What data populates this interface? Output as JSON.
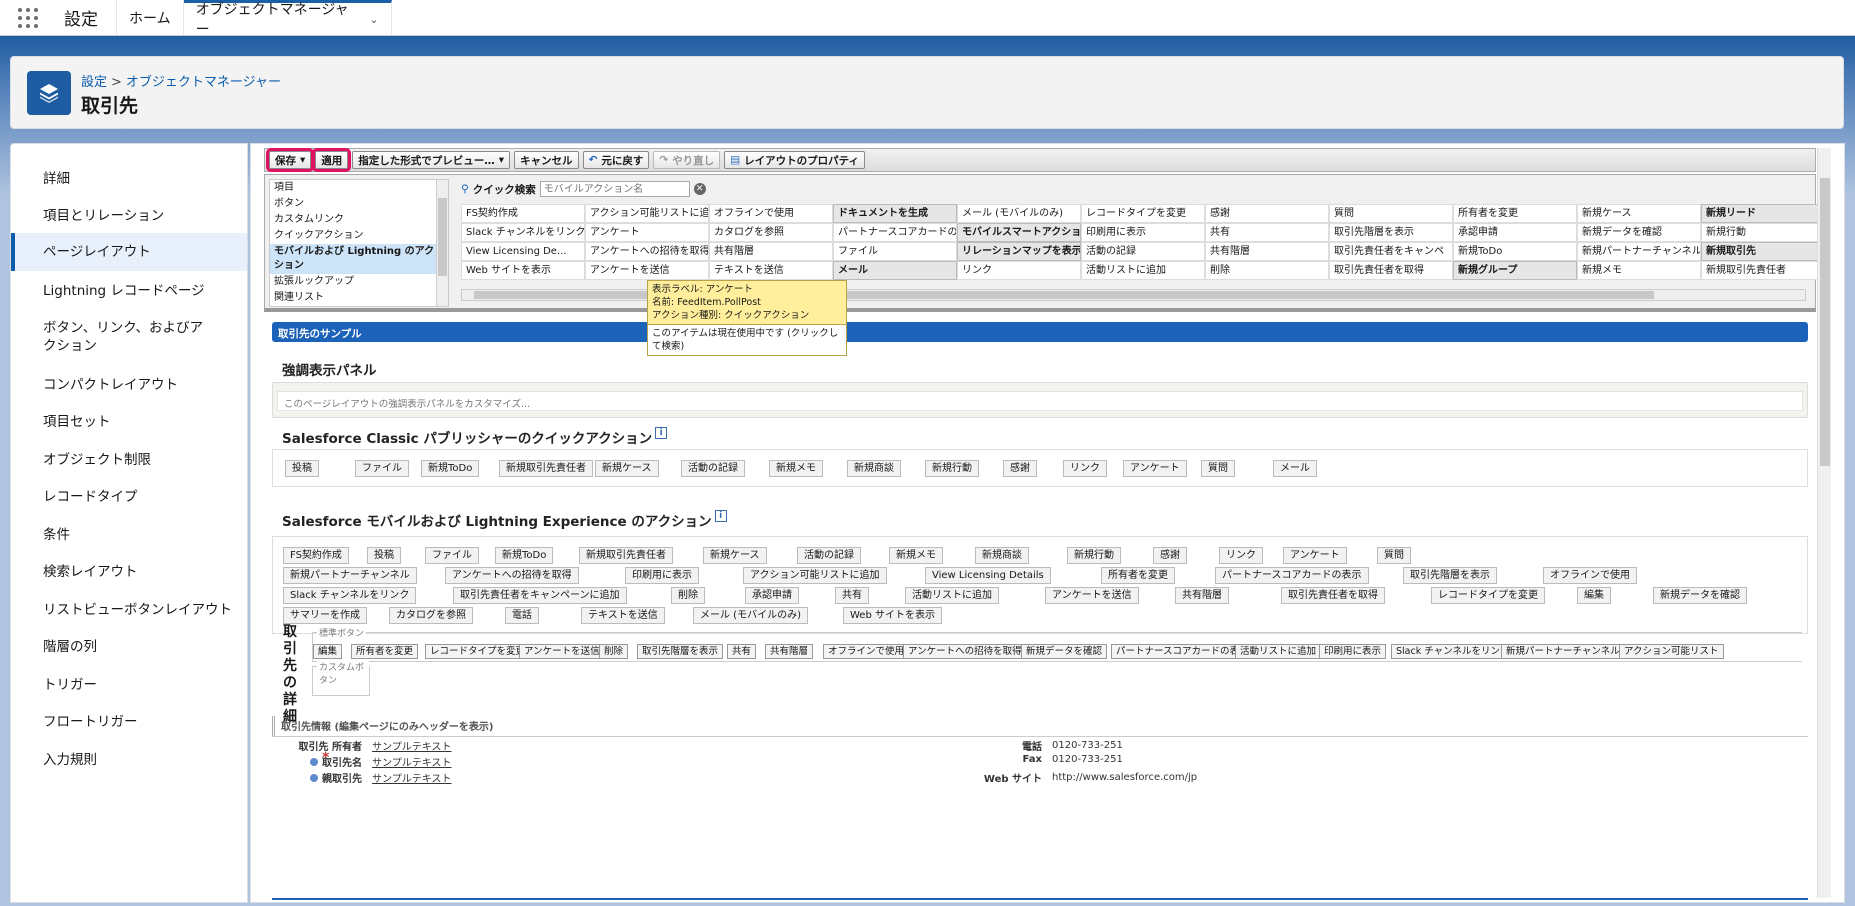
{
  "topbar": {
    "app_name": "設定",
    "tabs": [
      {
        "label": "ホーム"
      },
      {
        "label": "オブジェクトマネージャー"
      }
    ]
  },
  "header": {
    "breadcrumb_setup": "設定",
    "breadcrumb_sep": ">",
    "breadcrumb_objmgr": "オブジェクトマネージャー",
    "title": "取引先",
    "icon": "layers-icon"
  },
  "sidebar": {
    "items": [
      "詳細",
      "項目とリレーション",
      "ページレイアウト",
      "Lightning レコードページ",
      "ボタン、リンク、およびアクション",
      "コンパクトレイアウト",
      "項目セット",
      "オブジェクト制限",
      "レコードタイプ",
      "条件",
      "検索レイアウト",
      "リストビューボタンレイアウト",
      "階層の列",
      "トリガー",
      "フロートリガー",
      "入力規則"
    ],
    "active_index": 2
  },
  "toolbar": {
    "save": "保存",
    "apply": "適用",
    "preview": "指定した形式でプレビュー…",
    "cancel": "キャンセル",
    "undo": "元に戻す",
    "redo": "やり直し",
    "layout_props": "レイアウトのプロパティ"
  },
  "palette": {
    "categories": [
      "項目",
      "ボタン",
      "カスタムリンク",
      "クイックアクション",
      "モバイルおよび Lightning のアクション",
      "拡張ルックアップ",
      "関連リスト"
    ],
    "selected_index": 4,
    "quick_search_label": "クイック検索",
    "quick_search_placeholder": "モバイルアクション名",
    "rows": [
      [
        "FS契約作成",
        "アクション可能リストに追加",
        "オフラインで使用",
        "ドキュメントを生成",
        "メール (モバイルのみ)",
        "レコードタイプを変更",
        "感謝",
        "質問",
        "所有者を変更",
        "新規ケース",
        "新規リード"
      ],
      [
        "Slack チャンネルをリンク",
        "アンケート",
        "カタログを参照",
        "パートナースコアカードの表",
        "モバイルスマートアクション",
        "印刷用に表示",
        "共有",
        "取引先階層を表示",
        "承認申請",
        "新規データを確認",
        "新規行動"
      ],
      [
        "View Licensing De...",
        "アンケートへの招待を取得",
        "共有階層",
        "ファイル",
        "リレーションマップを表示",
        "活動の記録",
        "共有階層",
        "取引先責任者をキャンペ",
        "新規ToDo",
        "新規パートナーチャンネル",
        "新規取引先"
      ],
      [
        "Web サイトを表示",
        "アンケートを送信",
        "テキストを送信",
        "メール",
        "リンク",
        "活動リストに追加",
        "削除",
        "取引先責任者を取得",
        "新規グループ",
        "新規メモ",
        "新規取引先責任者"
      ]
    ],
    "bold_cells": [
      [
        0,
        3
      ],
      [
        0,
        10
      ],
      [
        1,
        4
      ],
      [
        2,
        4
      ],
      [
        2,
        10
      ],
      [
        3,
        3
      ],
      [
        3,
        8
      ]
    ],
    "tooltip": {
      "line1": "表示ラベル: アンケート",
      "line2": "名前: FeedItem.PollPost",
      "line3": "アクション種別: クイックアクション",
      "note": "このアイテムは現在使用中です (クリックして検索)"
    }
  },
  "canvas": {
    "section_title": "取引先のサンプル",
    "highlights_title": "強調表示パネル",
    "highlights_placeholder": "このページレイアウトの強調表示パネルをカスタマイズ...",
    "classic_title": "Salesforce Classic パブリッシャーのクイックアクション",
    "classic_actions": [
      "投稿",
      "ファイル",
      "新規ToDo",
      "新規取引先責任者",
      "新規ケース",
      "活動の記録",
      "新規メモ",
      "新規商談",
      "新規行動",
      "感謝",
      "リンク",
      "アンケート",
      "質問",
      "メール"
    ],
    "mobile_title": "Salesforce モバイルおよび Lightning Experience のアクション",
    "mobile_rows": [
      [
        "FS契約作成",
        "投稿",
        "ファイル",
        "新規ToDo",
        "新規取引先責任者",
        "新規ケース",
        "活動の記録",
        "新規メモ",
        "新規商談",
        "新規行動",
        "感謝",
        "リンク",
        "アンケート",
        "質問"
      ],
      [
        "新規パートナーチャンネル",
        "アンケートへの招待を取得",
        "印刷用に表示",
        "アクション可能リストに追加",
        "View Licensing Details",
        "所有者を変更",
        "パートナースコアカードの表示",
        "取引先階層を表示",
        "オフラインで使用"
      ],
      [
        "Slack チャンネルをリンク",
        "取引先責任者をキャンペーンに追加",
        "削除",
        "承認申請",
        "共有",
        "活動リストに追加",
        "アンケートを送信",
        "共有階層",
        "取引先責任者を取得",
        "レコードタイプを変更",
        "編集",
        "新規データを確認"
      ],
      [
        "サマリーを作成",
        "カタログを参照",
        "電話",
        "テキストを送信",
        "メール (モバイルのみ)",
        "Web サイトを表示"
      ]
    ],
    "detail_label": "取引先の詳細",
    "std_buttons_legend": "標準ボタン",
    "std_buttons": [
      "編集",
      "所有者を変更",
      "レコードタイプを変更",
      "アンケートを送信",
      "削除",
      "取引先階層を表示",
      "共有",
      "共有階層",
      "オフラインで使用",
      "アンケートへの招待を取得",
      "新規データを確認",
      "パートナースコアカードの表示",
      "活動リストに追加",
      "印刷用に表示",
      "Slack チャンネルをリンク",
      "新規パートナーチャンネル",
      "アクション可能リスト"
    ],
    "custom_buttons_legend": "カスタムボタン",
    "account_info_header": "取引先情報 (編集ページにのみヘッダーを表示)",
    "fields_left": [
      {
        "label": "取引先 所有者",
        "value": "サンプルテキスト"
      },
      {
        "label": "取引先名",
        "value": "サンプルテキスト"
      },
      {
        "label": "親取引先",
        "value": "サンプルテキスト"
      }
    ],
    "fields_right": [
      {
        "label": "電話",
        "value": "0120-733-251"
      },
      {
        "label": "Fax",
        "value": "0120-733-251"
      },
      {
        "label": "Web サイト",
        "value": "http://www.salesforce.com/jp"
      }
    ]
  }
}
